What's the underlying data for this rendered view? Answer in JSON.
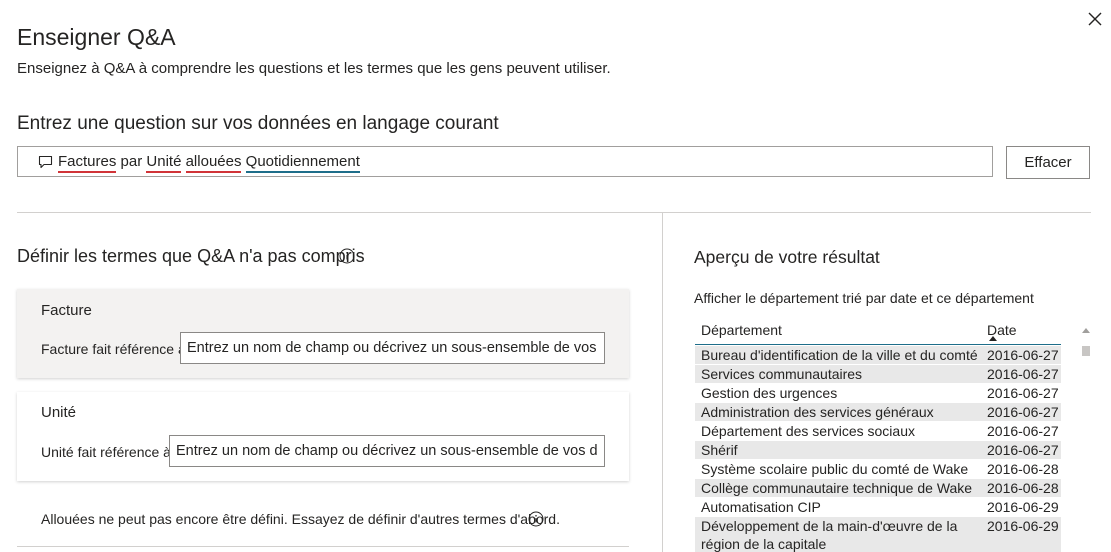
{
  "dialog": {
    "title": "Enseigner Q&A",
    "subtitle": "Enseignez à Q&A à comprendre les questions et les termes que les gens peuvent utiliser.",
    "close_icon": "close-icon"
  },
  "question": {
    "heading": "Entrez une question sur vos données en langage courant",
    "icon": "chat-bubble-icon",
    "words": {
      "w1": "Factures",
      "w2": "par",
      "w3": "Unité",
      "w4": "allouées",
      "w5": "Quotidiennement"
    },
    "error_underline_color": "#d13438",
    "recognized_underline_color": "#1e6e8a",
    "clear_label": "Effacer"
  },
  "define": {
    "heading": "Définir les termes que Q&A n'a pas compris",
    "info_icon": "info-icon",
    "terms": [
      {
        "name": "Facture",
        "label": "Facture fait référence à",
        "placeholder": "Entrez un nom de champ ou décrivez un sous-ensemble de vos données"
      },
      {
        "name": "Unité",
        "label": "Unité fait référence à",
        "placeholder": "Entrez un nom de champ ou décrivez un sous-ensemble de vos données"
      }
    ],
    "undefined_message": "Allouées ne peut pas encore être défini. Essayez de définir d'autres termes d'abord."
  },
  "preview": {
    "heading": "Aperçu de votre résultat",
    "caption": "Afficher le département trié par date et ce département",
    "columns": {
      "department": "Département",
      "date": "Date"
    },
    "rows": [
      {
        "department": "Bureau d'identification de la ville et du comté",
        "date": "2016-06-27"
      },
      {
        "department": "Services communautaires",
        "date": "2016-06-27"
      },
      {
        "department": "Gestion des urgences",
        "date": "2016-06-27"
      },
      {
        "department": "Administration des services généraux",
        "date": "2016-06-27"
      },
      {
        "department": "Département des services sociaux",
        "date": "2016-06-27"
      },
      {
        "department": "Shérif",
        "date": "2016-06-27"
      },
      {
        "department": "Système scolaire public du comté de Wake",
        "date": "2016-06-28"
      },
      {
        "department": "Collège communautaire technique de Wake",
        "date": "2016-06-28"
      },
      {
        "department": "Automatisation CIP",
        "date": "2016-06-29"
      },
      {
        "department": "Développement de la main-d'œuvre de la région de la capitale",
        "date": "2016-06-29"
      }
    ],
    "row_alt_color": "#e8e8e8",
    "sort_indicator": "sort-ascending-icon"
  }
}
